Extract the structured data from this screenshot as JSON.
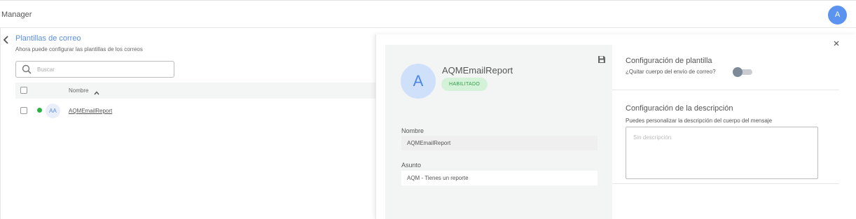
{
  "topbar": {
    "app_name": "Manager",
    "user_initial": "A"
  },
  "left": {
    "title": "Plantillas de correo",
    "subtitle": "Ahora puede configurar las plantillas de los correos",
    "search_placeholder": "Buscar",
    "table": {
      "columns": [
        "Nombre"
      ],
      "rows": [
        {
          "initials": "AA",
          "name": "AQMEmailReport",
          "status_color": "#27b43e"
        }
      ]
    }
  },
  "drawer": {
    "template": {
      "initial": "A",
      "name": "AQMEmailReport",
      "status": "HABILITADO"
    },
    "fields": {
      "name_label": "Nombre",
      "name_value": "AQMEmailReport",
      "subject_label": "Asunto",
      "subject_value": "AQM - Tienes un reporte"
    },
    "config": {
      "title": "Configuración de plantilla",
      "toggle_label": "¿Quitar cuerpo del envío de correo?",
      "toggle_on": false
    },
    "description": {
      "title": "Configuración de la descripción",
      "subtitle": "Puedes personalizar la descripción del cuerpo del mensaje",
      "placeholder": "Sin descripción",
      "value": ""
    }
  },
  "colors": {
    "accent": "#5b8fe0",
    "success": "#27b43e",
    "badge_bg": "#d4f2d8"
  },
  "icons": [
    "chevron-left-icon",
    "search-icon",
    "sort-up-icon",
    "save-icon",
    "close-icon"
  ]
}
